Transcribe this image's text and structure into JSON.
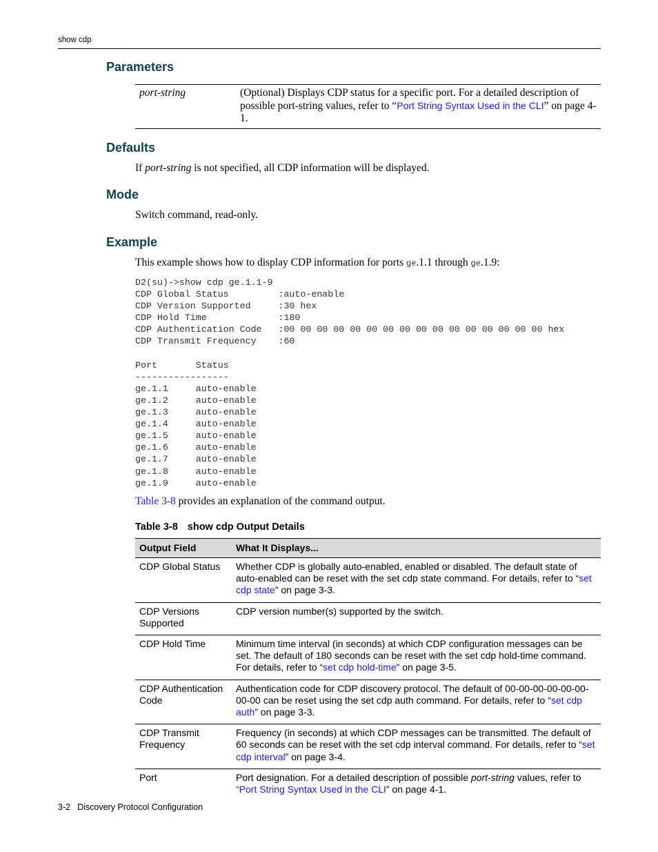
{
  "running_head": "show cdp",
  "sections": {
    "parameters": {
      "title": "Parameters",
      "rows": [
        {
          "name": "port-string",
          "desc_pre": "(Optional) Displays CDP status for a specific port. For a detailed description of possible port-string values, refer to “",
          "link": "Port String Syntax Used in the CLI",
          "desc_post": "” on page 4-1."
        }
      ]
    },
    "defaults": {
      "title": "Defaults",
      "text_pre": "If ",
      "text_italic": "port-string",
      "text_post": " is not specified, all CDP information will be displayed."
    },
    "mode": {
      "title": "Mode",
      "text": "Switch command, read-only."
    },
    "example": {
      "title": "Example",
      "intro_pre": "This example shows how to display CDP information for ports ",
      "intro_code1": "ge",
      "intro_mid": ".1.1 through ",
      "intro_code2": "ge",
      "intro_post": ".1.9:",
      "code_lines": [
        "D2(su)->show cdp ge.1.1-9",
        "CDP Global Status         :auto-enable",
        "CDP Version Supported     :30 hex",
        "CDP Hold Time             :180",
        "CDP Authentication Code   :00 00 00 00 00 00 00 00 00 00 00 00 00 00 00 00 hex",
        "CDP Transmit Frequency    :60",
        "",
        "Port       Status",
        "-----------------",
        "ge.1.1     auto-enable",
        "ge.1.2     auto-enable",
        "ge.1.3     auto-enable",
        "ge.1.4     auto-enable",
        "ge.1.5     auto-enable",
        "ge.1.6     auto-enable",
        "ge.1.7     auto-enable",
        "ge.1.8     auto-enable",
        "ge.1.9     auto-enable"
      ],
      "after_link": "Table 3-8",
      "after_text": " provides an explanation of the command output."
    }
  },
  "table": {
    "caption_num": "Table 3-8",
    "caption_title": "show cdp Output Details",
    "headers": [
      "Output Field",
      "What It Displays..."
    ],
    "rows": [
      {
        "field": "CDP Global Status",
        "pre": "Whether CDP is globally auto-enabled, enabled or disabled. The default state of auto-enabled can be reset with the set cdp state command. For details, refer to “",
        "link": "set cdp state",
        "post": "” on page 3-3."
      },
      {
        "field": "CDP Versions Supported",
        "pre": "CDP version number(s) supported by the switch.",
        "link": "",
        "post": ""
      },
      {
        "field": "CDP Hold Time",
        "pre": "Minimum time interval (in seconds) at which CDP configuration messages can be set. The default of 180 seconds can be reset with the set cdp hold-time command. For details, refer to “",
        "link": "set cdp hold-time",
        "post": "” on page 3-5."
      },
      {
        "field": "CDP Authentication Code",
        "pre": "Authentication code for CDP discovery protocol. The default of 00-00-00-00-00-00-00-00 can be reset using the set cdp auth command. For details, refer to “",
        "link": "set cdp auth",
        "post": "” on page 3-3."
      },
      {
        "field": "CDP Transmit Frequency",
        "pre": "Frequency (in seconds) at which CDP messages can be transmitted. The default of 60 seconds can be reset with the set cdp interval command. For details, refer to “",
        "link": "set cdp interval",
        "post": "” on page 3-4."
      },
      {
        "field": "Port",
        "pre": "Port designation. For a detailed description of possible ",
        "italic": "port-string",
        "pre2": " values, refer to ",
        "link": "“Port String Syntax Used in the CLI",
        "post": "” on page 4-1."
      }
    ]
  },
  "footer": {
    "page_number": "3-2",
    "chapter": "Discovery Protocol Configuration"
  },
  "colors": {
    "heading": "#0f4547",
    "link": "#1a1aff",
    "table_header_bg": "#d9d9d9"
  }
}
